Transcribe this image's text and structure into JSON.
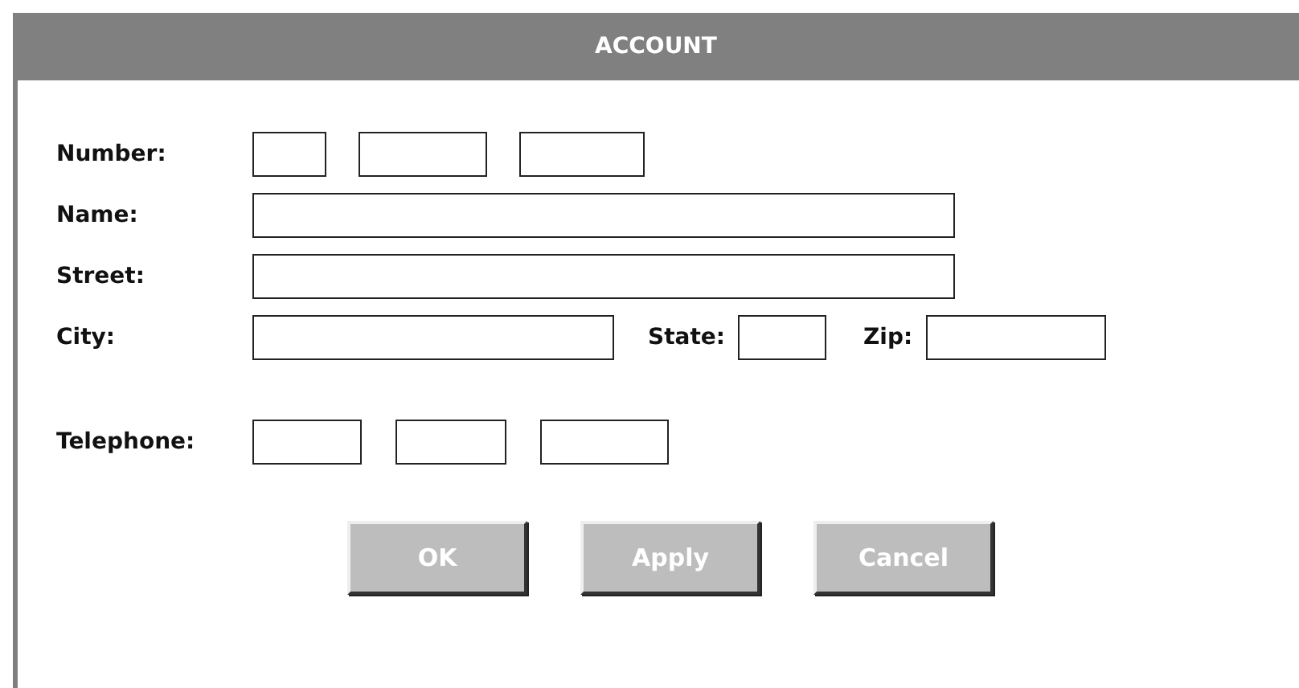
{
  "window": {
    "title": "ACCOUNT"
  },
  "rows": [
    {
      "kind": "number",
      "label": "Number:"
    },
    {
      "kind": "wide",
      "label": "Name:"
    },
    {
      "kind": "wide",
      "label": "Street:"
    },
    {
      "kind": "city",
      "label": "City:",
      "state_label": "State:",
      "zip_label": "Zip:"
    },
    {
      "kind": "phone",
      "label": "Telephone:"
    }
  ],
  "buttons": [
    "OK",
    "Apply",
    "Cancel"
  ]
}
